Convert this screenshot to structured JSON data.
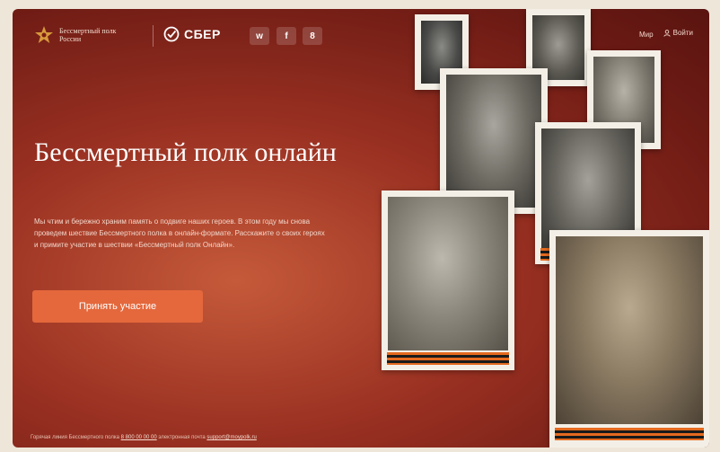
{
  "header": {
    "logo_text": "Бессмертный полк России",
    "partner": "СБЕР",
    "social": [
      "vk",
      "f",
      "ok"
    ],
    "nav_link": "Мир",
    "login": "Войти"
  },
  "hero": {
    "title": "Бессмертный полк онлайн",
    "description": "Мы чтим и бережно храним память о подвиге наших героев. В этом году мы снова проведем шествие Бессмертного полка в онлайн-формате. Расскажите о своих героях и примите участие в шествии «Бессмертный полк Онлайн».",
    "cta": "Принять участие"
  },
  "footer": {
    "text": "Горячая линия Бессмертного полка",
    "phone": "8 800 00 00 00",
    "email_prefix": "электронная почта",
    "email": "support@moypolk.ru"
  },
  "colors": {
    "accent": "#e4683c",
    "background": "#9a3122"
  }
}
